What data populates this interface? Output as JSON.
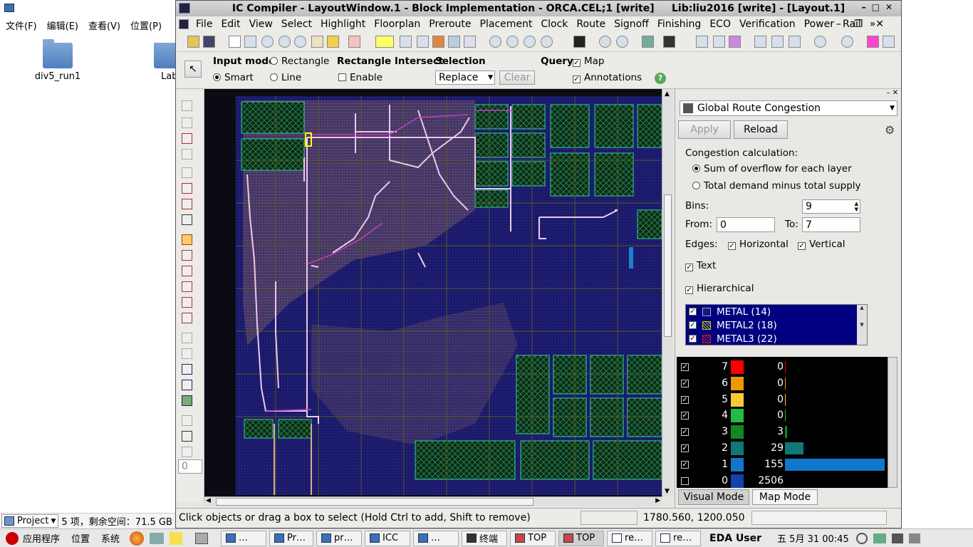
{
  "desktop": {
    "menu": [
      "文件(F)",
      "编辑(E)",
      "查看(V)",
      "位置(P)"
    ],
    "icons": [
      {
        "label": "div5_run1"
      },
      {
        "label": "Lab"
      }
    ],
    "status": {
      "location": "Project",
      "info": "5 项，剩余空间：71.5 GB"
    }
  },
  "taskbar": {
    "menu": [
      "应用程序",
      "位置",
      "系统"
    ],
    "tasks": [
      "…",
      "Pr…",
      "pr…",
      "ICC",
      "…",
      "终端",
      "TOP",
      "TOP",
      "re…",
      "re…"
    ],
    "user": "EDA User",
    "clock": "五 5月 31 00:45"
  },
  "window": {
    "title": "IC Compiler - LayoutWindow.1 - Block Implementation - ORCA.CEL;1 [write]     Lib:liu2016 [write] - [Layout.1]",
    "menu": [
      "File",
      "Edit",
      "View",
      "Select",
      "Highlight",
      "Floorplan",
      "Preroute",
      "Placement",
      "Clock",
      "Route",
      "Signoff",
      "Finishing",
      "ECO",
      "Verification",
      "Power",
      "Rail",
      "»"
    ]
  },
  "options": {
    "input_mode_label": "Input mode",
    "rectangle": "Rectangle",
    "smart": "Smart",
    "line": "Line",
    "rect_intersect_label": "Rectangle Intersect",
    "enable": "Enable",
    "selection_label": "Selection",
    "selection_value": "Replace",
    "clear": "Clear",
    "query_label": "Query",
    "map": "Map",
    "annotations": "Annotations",
    "help": "?"
  },
  "left_field": "0",
  "status": {
    "message": "Click objects or drag a box to select (Hold Ctrl to add, Shift to remove)",
    "coords": "1780.560, 1200.050"
  },
  "panel": {
    "mode": "Global Route Congestion",
    "apply": "Apply",
    "reload": "Reload",
    "calc_label": "Congestion calculation:",
    "calc_opt1": "Sum of overflow for each layer",
    "calc_opt2": "Total demand minus total supply",
    "bins_label": "Bins:",
    "bins": "9",
    "from_label": "From:",
    "from": "0",
    "to_label": "To:",
    "to": "7",
    "edges_label": "Edges:",
    "horizontal": "Horizontal",
    "vertical": "Vertical",
    "text": "Text",
    "hierarchical": "Hierarchical",
    "layers": [
      {
        "name": "METAL (14)",
        "color": "#1a1a6e"
      },
      {
        "name": "METAL2 (18)",
        "color": "#c9c900"
      },
      {
        "name": "METAL3 (22)",
        "color": "#cc2222"
      }
    ],
    "bins_list": [
      {
        "bin": "7",
        "count": "0",
        "color": "#ff0000",
        "checked": true,
        "frac": 0.0
      },
      {
        "bin": "6",
        "count": "0",
        "color": "#ee9900",
        "checked": true,
        "frac": 0.0
      },
      {
        "bin": "5",
        "count": "0",
        "color": "#f5cc33",
        "checked": true,
        "frac": 0.0
      },
      {
        "bin": "4",
        "count": "0",
        "color": "#22bb44",
        "checked": true,
        "frac": 0.0
      },
      {
        "bin": "3",
        "count": "3",
        "color": "#118822",
        "checked": true,
        "frac": 0.019
      },
      {
        "bin": "2",
        "count": "29",
        "color": "#117777",
        "checked": true,
        "frac": 0.187
      },
      {
        "bin": "1",
        "count": "155",
        "color": "#1177cc",
        "checked": true,
        "frac": 1.0
      },
      {
        "bin": "0",
        "count": "2506",
        "color": "#1144aa",
        "checked": false,
        "frac": 0.0
      }
    ],
    "tabs": [
      "Visual Mode",
      "Map Mode"
    ]
  }
}
